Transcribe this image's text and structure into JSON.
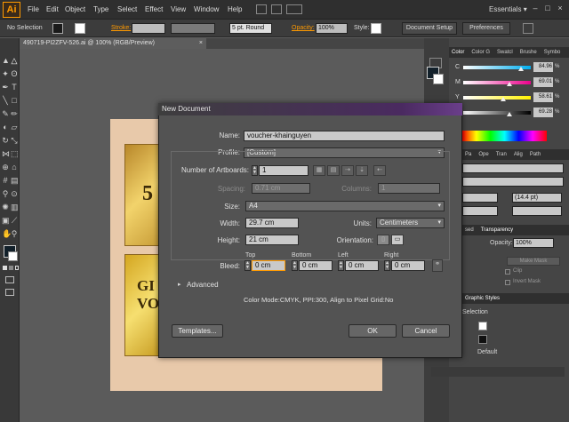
{
  "menubar": {
    "logo": "Ai",
    "items": [
      "File",
      "Edit",
      "Object",
      "Type",
      "Select",
      "Effect",
      "View",
      "Window",
      "Help"
    ],
    "workspace": "Essentials",
    "workspace_arrow": "▾",
    "window_controls": [
      "–",
      "□",
      "×"
    ]
  },
  "controlbar": {
    "selection": "No Selection",
    "stroke_label": "Stroke:",
    "brush": "5 pt. Round",
    "opacity_label": "Opacity:",
    "opacity": "100%",
    "style_label": "Style:",
    "document_setup": "Document Setup",
    "preferences": "Preferences"
  },
  "document": {
    "tab": "490719-PI2ZFV-526.ai @ 100% (RGB/Preview)",
    "close": "×"
  },
  "canvas": {
    "voucher1_text": "5",
    "voucher2_text1": "GI",
    "voucher2_text2": "VO"
  },
  "color_panel": {
    "tabs": [
      "Color",
      "Color G",
      "Swatcl",
      "Brushe",
      "Symbo"
    ],
    "sliders": [
      {
        "label": "C",
        "value": "84.96",
        "color_from": "#ffffff",
        "color_to": "#00aeef",
        "level": 0.85
      },
      {
        "label": "M",
        "value": "69.01",
        "color_from": "#ffffff",
        "color_to": "#ec008c",
        "level": 0.69
      },
      {
        "label": "Y",
        "value": "58.61",
        "color_from": "#ffffff",
        "color_to": "#fff200",
        "level": 0.59
      },
      {
        "label": "K",
        "value": "69.28",
        "color_from": "#ffffff",
        "color_to": "#000000",
        "level": 0.69
      }
    ],
    "percent": "%"
  },
  "type_panel": {
    "tabs": [
      "Pa",
      "Ope",
      "Tran",
      "Alig",
      "Path"
    ],
    "size": "(14.4 pt)"
  },
  "transparency_panel": {
    "tabs": [
      "sed",
      "Transparency"
    ],
    "opacity_label": "Opacity:",
    "opacity": "100%",
    "make_mask": "Make Mask",
    "clip": "Clip",
    "invert_mask": "Invert Mask"
  },
  "graphic_styles": {
    "title": "Graphic Styles",
    "selection": "Selection",
    "default": "Default"
  },
  "dialog": {
    "title": "New Document",
    "name_label": "Name:",
    "name_value": "voucher-khainguyen",
    "profile_label": "Profile:",
    "profile_value": "[Custom]",
    "artboards_label": "Number of Artboards:",
    "artboards_value": "1",
    "spacing_label": "Spacing:",
    "spacing_value": "0.71 cm",
    "columns_label": "Columns:",
    "columns_value": "1",
    "size_label": "Size:",
    "size_value": "A4",
    "width_label": "Width:",
    "width_value": "29.7 cm",
    "units_label": "Units:",
    "units_value": "Centimeters",
    "height_label": "Height:",
    "height_value": "21 cm",
    "orientation_label": "Orientation:",
    "bleed_label": "Bleed:",
    "bleed_top_label": "Top",
    "bleed_top": "0 cm",
    "bleed_bottom_label": "Bottom",
    "bleed_bottom": "0 cm",
    "bleed_left_label": "Left",
    "bleed_left": "0 cm",
    "bleed_right_label": "Right",
    "bleed_right": "0 cm",
    "advanced": "Advanced",
    "advanced_arrow": "▸",
    "summary": "Color Mode:CMYK, PPI:300, Align to Pixel Grid:No",
    "templates_button": "Templates...",
    "ok_button": "OK",
    "cancel_button": "Cancel",
    "dropdown_arrow": "▾"
  }
}
